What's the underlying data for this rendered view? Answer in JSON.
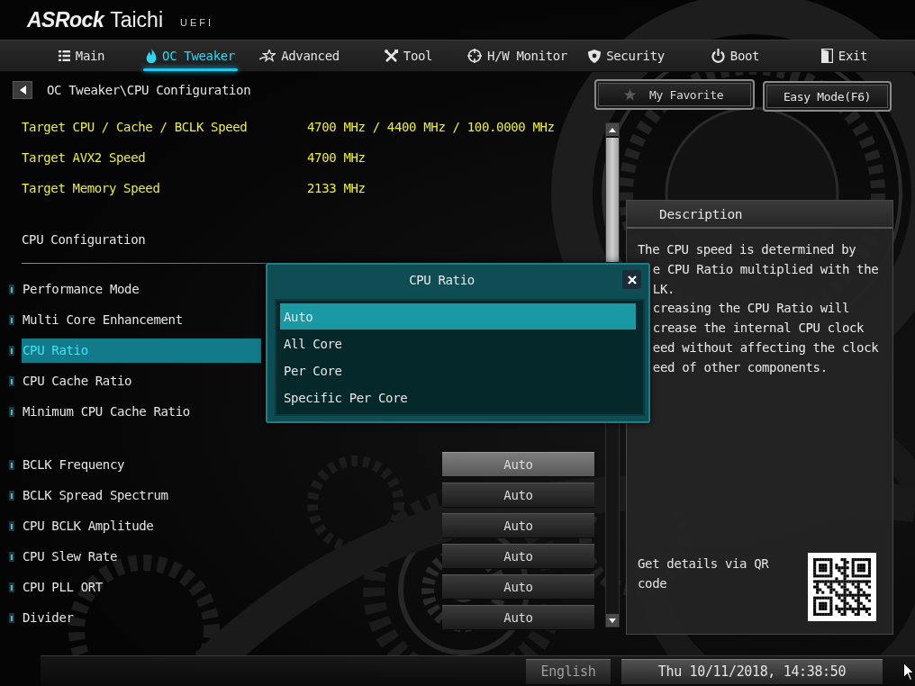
{
  "header": {
    "brand": "ASRock",
    "model": "Taichi",
    "edition": "UEFI"
  },
  "tabs": [
    {
      "label": "Main",
      "selected": false
    },
    {
      "label": "OC Tweaker",
      "selected": true
    },
    {
      "label": "Advanced",
      "selected": false
    },
    {
      "label": "Tool",
      "selected": false
    },
    {
      "label": "H/W Monitor",
      "selected": false
    },
    {
      "label": "Security",
      "selected": false
    },
    {
      "label": "Boot",
      "selected": false
    },
    {
      "label": "Exit",
      "selected": false
    }
  ],
  "breadcrumb": {
    "path": "OC Tweaker\\CPU Configuration"
  },
  "favorite_button": {
    "label": "My Favorite"
  },
  "easy_mode_button": {
    "label": "Easy Mode(F6)"
  },
  "info_rows": [
    {
      "label": "Target CPU / Cache / BCLK Speed",
      "value": "4700 MHz / 4400 MHz / 100.0000 MHz"
    },
    {
      "label": "Target AVX2 Speed",
      "value": "4700 MHz"
    },
    {
      "label": "Target Memory Speed",
      "value": "2133 MHz"
    }
  ],
  "section": {
    "title": "CPU Configuration",
    "groups": [
      {
        "items": [
          {
            "label": "Performance Mode",
            "selected": false
          },
          {
            "label": "Multi Core Enhancement",
            "selected": false
          },
          {
            "label": "CPU Ratio",
            "selected": true
          },
          {
            "label": "CPU Cache Ratio",
            "selected": false
          },
          {
            "label": "Minimum CPU Cache Ratio",
            "selected": false
          }
        ]
      },
      {
        "items": [
          {
            "label": "BCLK Frequency",
            "selected": false,
            "value": "Auto",
            "highlighted": true
          },
          {
            "label": "BCLK Spread Spectrum",
            "selected": false,
            "value": "Auto",
            "highlighted": false
          },
          {
            "label": "CPU BCLK Amplitude",
            "selected": false,
            "value": "Auto",
            "highlighted": false
          },
          {
            "label": "CPU Slew Rate",
            "selected": false,
            "value": "Auto",
            "highlighted": false
          },
          {
            "label": "CPU PLL ORT",
            "selected": false,
            "value": "Auto",
            "highlighted": false
          },
          {
            "label": "Divider",
            "selected": false,
            "value": "Auto",
            "highlighted": false
          }
        ]
      }
    ]
  },
  "popup": {
    "title": "CPU Ratio",
    "options": [
      {
        "label": "Auto",
        "selected": true
      },
      {
        "label": "All Core",
        "selected": false
      },
      {
        "label": "Per Core",
        "selected": false
      },
      {
        "label": "Specific Per Core",
        "selected": false
      }
    ]
  },
  "description": {
    "title": "Description",
    "lines": [
      {
        "text": "The CPU speed is determined by",
        "partly_hidden": false
      },
      {
        "text": "e CPU Ratio multiplied with the",
        "partly_hidden": true
      },
      {
        "text": "LK.",
        "partly_hidden": true
      },
      {
        "text": "creasing the CPU Ratio will",
        "partly_hidden": true
      },
      {
        "text": "crease the internal CPU clock",
        "partly_hidden": true
      },
      {
        "text": "eed without affecting the clock",
        "partly_hidden": true
      },
      {
        "text": "eed of other components.",
        "partly_hidden": true
      }
    ]
  },
  "qr": {
    "caption": "Get details via QR code"
  },
  "status_bar": {
    "language": "English",
    "datetime": "Thu 10/11/2018, 14:38:50"
  }
}
